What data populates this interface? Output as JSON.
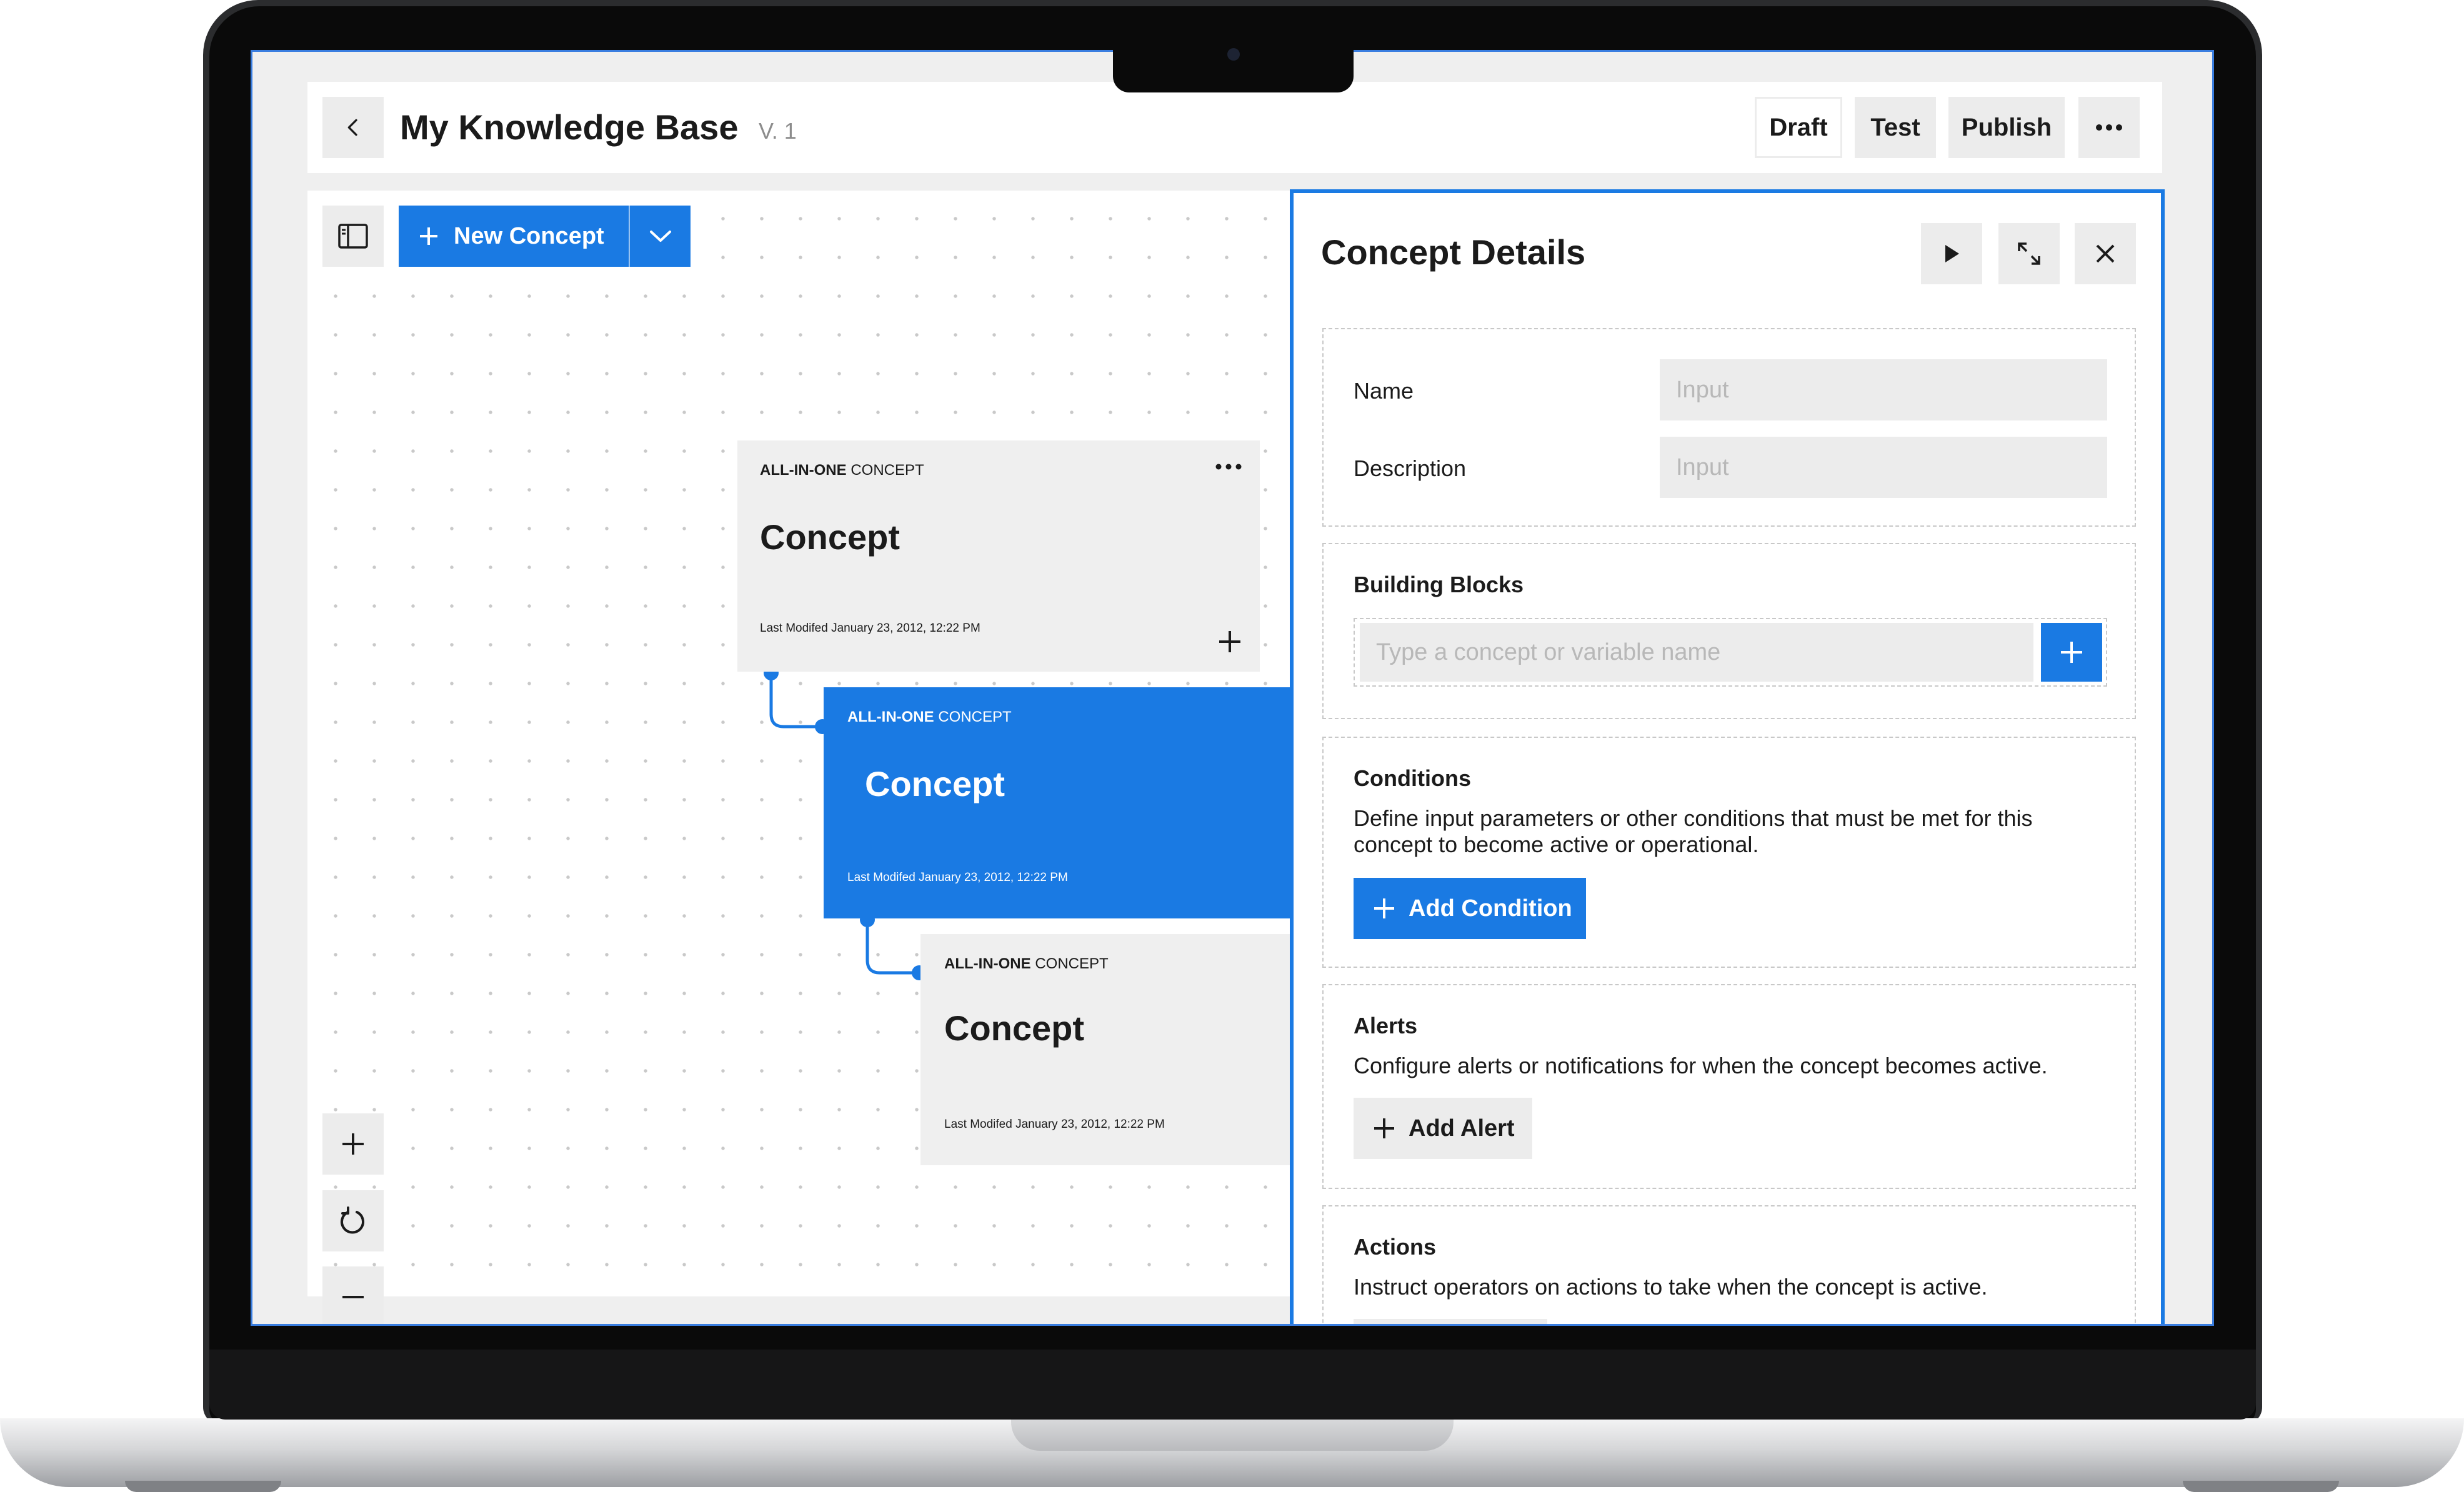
{
  "header": {
    "title": "My Knowledge Base",
    "version": "V. 1",
    "draft_label": "Draft",
    "test_label": "Test",
    "publish_label": "Publish",
    "more_icon": "ellipsis-icon",
    "back_icon": "chevron-left-icon"
  },
  "toolbar": {
    "new_concept_label": "New Concept",
    "panel_icon": "sidebar-icon",
    "dropdown_icon": "chevron-down-icon"
  },
  "canvas": {
    "cards": [
      {
        "kind_bold": "ALL-IN-ONE",
        "kind_rest": " CONCEPT",
        "title": "Concept",
        "modified": "Last Modifed January 23, 2012, 12:22 PM",
        "selected": false
      },
      {
        "kind_bold": "ALL-IN-ONE",
        "kind_rest": " CONCEPT",
        "title": "Concept",
        "modified": "Last Modifed January 23, 2012, 12:22 PM",
        "selected": true
      },
      {
        "kind_bold": "ALL-IN-ONE",
        "kind_rest": " CONCEPT",
        "title": "Concept",
        "modified": "Last Modifed January 23, 2012, 12:22 PM",
        "selected": false
      }
    ],
    "zoom_controls": [
      "plus-icon",
      "reset-icon",
      "minus-icon"
    ]
  },
  "details": {
    "title": "Concept Details",
    "name_label": "Name",
    "name_placeholder": "Input",
    "description_label": "Description",
    "description_placeholder": "Input",
    "building_blocks_heading": "Building Blocks",
    "building_blocks_placeholder": "Type a concept or variable name",
    "conditions_heading": "Conditions",
    "conditions_description": "Define input parameters or other conditions that must be met for this concept to become active or operational.",
    "add_condition_label": "Add Condition",
    "alerts_heading": "Alerts",
    "alerts_description": "Configure alerts or notifications for when the concept becomes active.",
    "add_alert_label": "Add Alert",
    "actions_heading": "Actions",
    "actions_description": "Instruct operators on actions to take when the concept is active."
  },
  "colors": {
    "accent": "#1a7ae3",
    "surface": "#efefef",
    "text": "#1b1b1b",
    "muted": "#b8b8b8"
  }
}
